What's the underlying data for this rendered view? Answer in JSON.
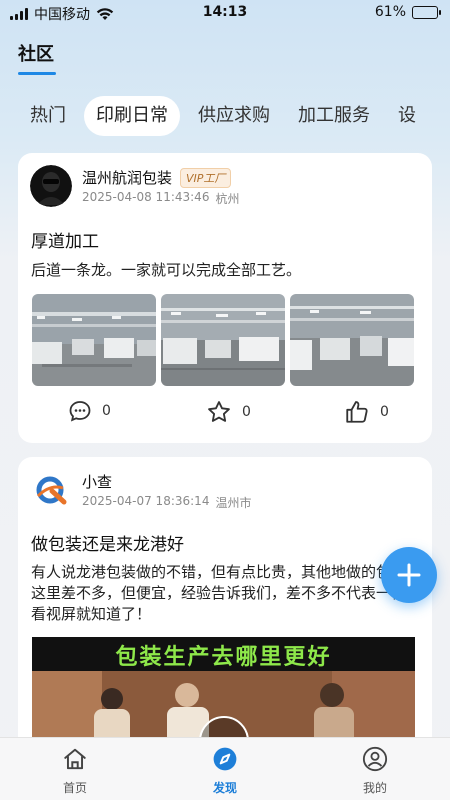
{
  "status_bar": {
    "carrier": "中国移动",
    "time": "14:13",
    "battery": "61%",
    "battery_level": 0.61
  },
  "header": {
    "title": "社区"
  },
  "tabs": [
    {
      "label": "热门"
    },
    {
      "label": "印刷日常",
      "active": true
    },
    {
      "label": "供应求购"
    },
    {
      "label": "加工服务"
    },
    {
      "label": "设"
    }
  ],
  "posts": [
    {
      "author": "温州航润包装",
      "badge": "VIP工厂",
      "datetime": "2025-04-08 11:43:46",
      "location": "杭州",
      "title": "厚道加工",
      "body": "后道一条龙。一家就可以完成全部工艺。",
      "comments": "0",
      "favorites": "0",
      "likes": "0"
    },
    {
      "author": "小查",
      "datetime": "2025-04-07 18:36:14",
      "location": "温州市",
      "title": "做包装还是来龙港好",
      "body": "有人说龙港包装做的不错，但有点比贵，其他地做的包装和这里差不多，但便宜，经验告诉我们，差不多不代表一样，看视屏就知道了！",
      "video_caption": "包装生产去哪里更好"
    }
  ],
  "fab": {
    "icon": "plus-icon"
  },
  "bottom_nav": [
    {
      "label": "首页",
      "icon": "home-icon"
    },
    {
      "label": "发现",
      "icon": "compass-icon",
      "active": true
    },
    {
      "label": "我的",
      "icon": "user-icon"
    }
  ],
  "colors": {
    "accent": "#1e88e5",
    "fab": "#3a9bf0",
    "vip_text": "#b0702b"
  }
}
